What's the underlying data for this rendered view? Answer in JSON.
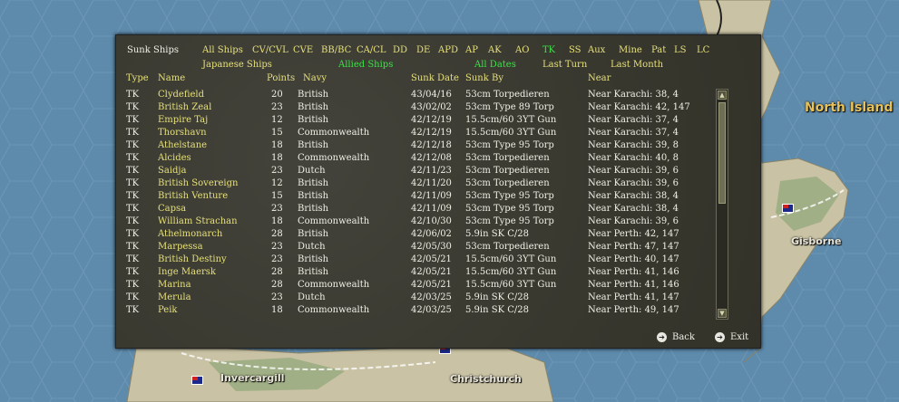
{
  "map": {
    "labels": {
      "north_island": "North Island",
      "gisborne": "Gisborne",
      "invercargill": "Invercargill",
      "christchurch": "Christchurch"
    }
  },
  "panel": {
    "title": "Sunk Ships",
    "filters_row1": [
      "All Ships",
      "CV/CVL",
      "CVE",
      "BB/BC",
      "CA/CL",
      "DD",
      "DE",
      "APD",
      "AP",
      "AK",
      "AO",
      "TK",
      "SS",
      "Aux",
      "Mine",
      "Pat",
      "LS",
      "LC"
    ],
    "active_type_filter": "TK",
    "filters_row2": {
      "japanese": "Japanese Ships",
      "allied": "Allied Ships",
      "all_dates": "All Dates",
      "last_turn": "Last Turn",
      "last_month": "Last Month"
    },
    "columns": {
      "type": "Type",
      "name": "Name",
      "points": "Points",
      "navy": "Navy",
      "sunk_date": "Sunk Date",
      "sunk_by": "Sunk By",
      "near": "Near"
    },
    "rows": [
      {
        "type": "TK",
        "name": "Clydefield",
        "points": "20",
        "navy": "British",
        "date": "43/04/16",
        "by": "53cm Torpedieren",
        "near": "Near Karachi: 38, 4"
      },
      {
        "type": "TK",
        "name": "British Zeal",
        "points": "23",
        "navy": "British",
        "date": "43/02/02",
        "by": "53cm Type 89 Torp",
        "near": "Near Karachi: 42, 147"
      },
      {
        "type": "TK",
        "name": "Empire Taj",
        "points": "12",
        "navy": "British",
        "date": "42/12/19",
        "by": "15.5cm/60 3YT Gun",
        "near": "Near Karachi: 37, 4"
      },
      {
        "type": "TK",
        "name": "Thorshavn",
        "points": "15",
        "navy": "Commonwealth",
        "date": "42/12/19",
        "by": "15.5cm/60 3YT Gun",
        "near": "Near Karachi: 37, 4"
      },
      {
        "type": "TK",
        "name": "Athelstane",
        "points": "18",
        "navy": "British",
        "date": "42/12/18",
        "by": "53cm Type 95 Torp",
        "near": "Near Karachi: 39, 8"
      },
      {
        "type": "TK",
        "name": "Alcides",
        "points": "18",
        "navy": "Commonwealth",
        "date": "42/12/08",
        "by": "53cm Torpedieren",
        "near": "Near Karachi: 40, 8"
      },
      {
        "type": "TK",
        "name": "Saidja",
        "points": "23",
        "navy": "Dutch",
        "date": "42/11/23",
        "by": "53cm Torpedieren",
        "near": "Near Karachi: 39, 6"
      },
      {
        "type": "TK",
        "name": "British Sovereign",
        "points": "12",
        "navy": "British",
        "date": "42/11/20",
        "by": "53cm Torpedieren",
        "near": "Near Karachi: 39, 6"
      },
      {
        "type": "TK",
        "name": "British Venture",
        "points": "15",
        "navy": "British",
        "date": "42/11/09",
        "by": "53cm Type 95 Torp",
        "near": "Near Karachi: 38, 4"
      },
      {
        "type": "TK",
        "name": "Capsa",
        "points": "23",
        "navy": "British",
        "date": "42/11/09",
        "by": "53cm Type 95 Torp",
        "near": "Near Karachi: 38, 4"
      },
      {
        "type": "TK",
        "name": "William Strachan",
        "points": "18",
        "navy": "Commonwealth",
        "date": "42/10/30",
        "by": "53cm Type 95 Torp",
        "near": "Near Karachi: 39, 6"
      },
      {
        "type": "TK",
        "name": "Athelmonarch",
        "points": "28",
        "navy": "British",
        "date": "42/06/02",
        "by": "5.9in SK C/28",
        "near": "Near Perth: 42, 147"
      },
      {
        "type": "TK",
        "name": "Marpessa",
        "points": "23",
        "navy": "Dutch",
        "date": "42/05/30",
        "by": "53cm Torpedieren",
        "near": "Near Perth: 47, 147"
      },
      {
        "type": "TK",
        "name": "British Destiny",
        "points": "23",
        "navy": "British",
        "date": "42/05/21",
        "by": "15.5cm/60 3YT Gun",
        "near": "Near Perth: 40, 147"
      },
      {
        "type": "TK",
        "name": "Inge Maersk",
        "points": "28",
        "navy": "British",
        "date": "42/05/21",
        "by": "15.5cm/60 3YT Gun",
        "near": "Near Perth: 41, 146"
      },
      {
        "type": "TK",
        "name": "Marina",
        "points": "28",
        "navy": "Commonwealth",
        "date": "42/05/21",
        "by": "15.5cm/60 3YT Gun",
        "near": "Near Perth: 41, 146"
      },
      {
        "type": "TK",
        "name": "Merula",
        "points": "23",
        "navy": "Dutch",
        "date": "42/03/25",
        "by": "5.9in SK C/28",
        "near": "Near Perth: 41, 147"
      },
      {
        "type": "TK",
        "name": "Peik",
        "points": "18",
        "navy": "Commonwealth",
        "date": "42/03/25",
        "by": "5.9in SK C/28",
        "near": "Near Perth: 49, 147"
      }
    ],
    "buttons": {
      "back": "Back",
      "exit": "Exit"
    }
  }
}
